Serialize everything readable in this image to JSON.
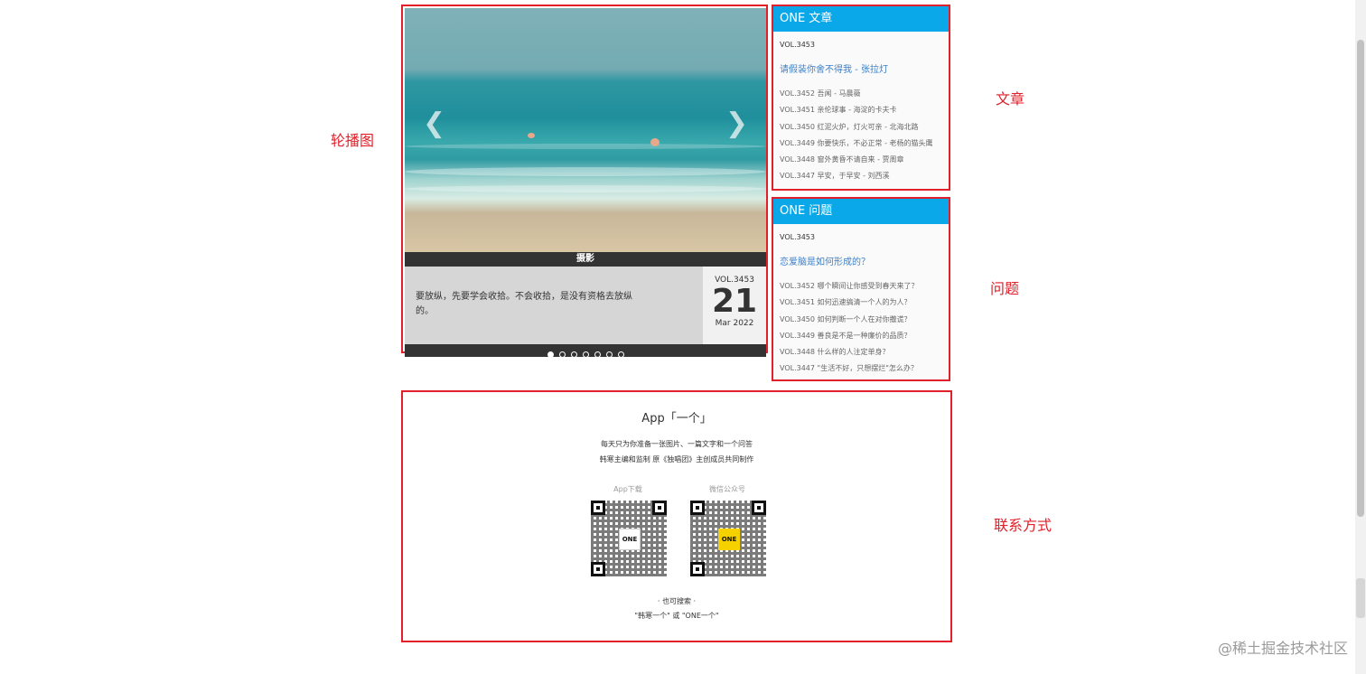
{
  "annotations": {
    "carousel": "轮播图",
    "article": "文章",
    "question": "问题",
    "contact": "联系方式"
  },
  "carousel": {
    "prev_icon": "chevron-left-icon",
    "next_icon": "chevron-right-icon",
    "caption": "摄影",
    "quote": "要放纵，先要学会收拾。不会收拾，是没有资格去放纵的。",
    "vol": "VOL.3453",
    "day": "21",
    "month_year": "Mar 2022",
    "dots_total": 7,
    "dots_active": 0
  },
  "article_panel": {
    "title": "ONE 文章",
    "vol": "VOL.3453",
    "headline": "请假装你舍不得我 - 张拉灯",
    "items": [
      "VOL.3452 吾闻 - 马晨薇",
      "VOL.3451 亲伦球事 - 海淀的卡夫卡",
      "VOL.3450 红泥火炉，灯火可亲 - 北海北路",
      "VOL.3449 你要快乐，不必正常 - 老杨的猫头鹰",
      "VOL.3448 窗外黄昏不请自来 - 贾周章",
      "VOL.3447 早安，于早安 - 刘西溪"
    ]
  },
  "question_panel": {
    "title": "ONE 问题",
    "vol": "VOL.3453",
    "headline": "恋爱脑是如何形成的？",
    "items": [
      "VOL.3452 哪个瞬间让你感受到春天来了？",
      "VOL.3451 如何迅速搞清一个人的为人？",
      "VOL.3450 如何判断一个人在对你撒谎？",
      "VOL.3449 善良是不是一种廉价的品质？",
      "VOL.3448 什么样的人注定单身？",
      "VOL.3447 \"生活不好，只想摆烂\"怎么办？"
    ]
  },
  "contact": {
    "title": "App「一个」",
    "desc_line1": "每天只为你准备一张图片、一篇文字和一个问答",
    "desc_line2": "韩寒主编和监制 原《独唱团》主创成员共同制作",
    "qr1_label": "App下载",
    "qr2_label": "微信公众号",
    "qr_logo": "ONE",
    "search_line1": "· 也可搜索 ·",
    "search_line2": "\"韩寒一个\" 或 \"ONE一个\""
  },
  "watermark": "@稀土掘金技术社区"
}
